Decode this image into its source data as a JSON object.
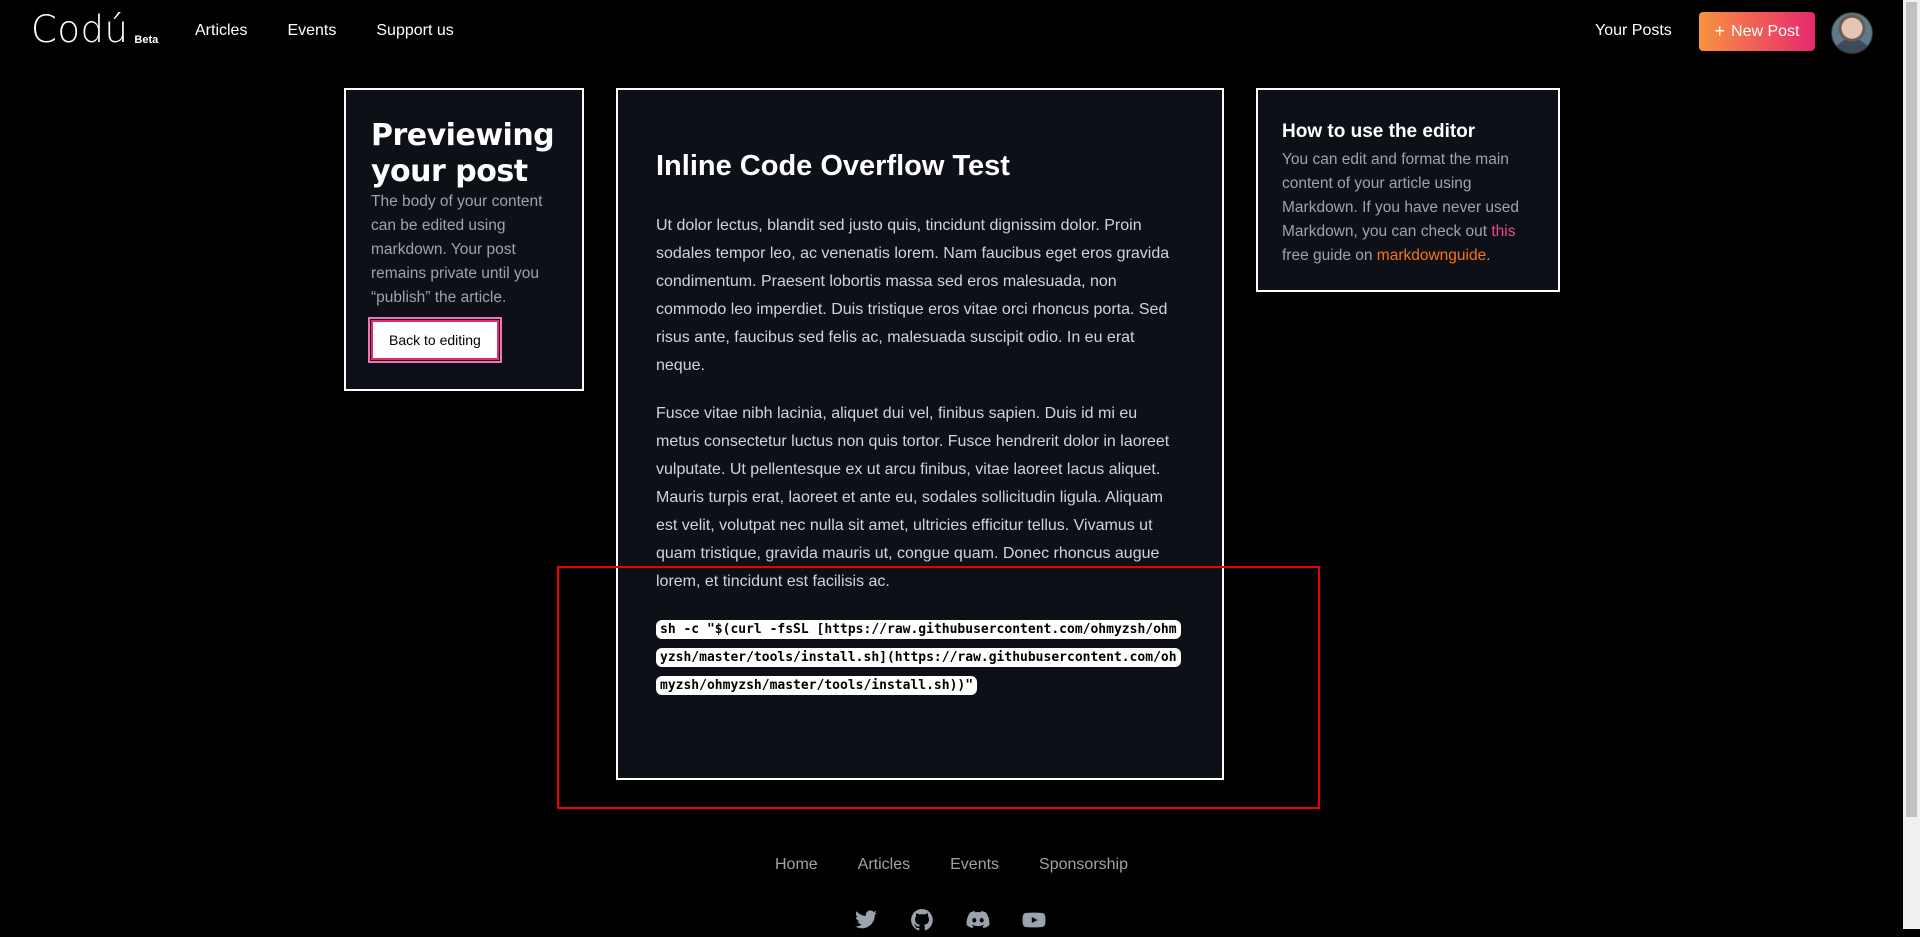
{
  "header": {
    "logo_text": "Codú",
    "logo_badge": "Beta",
    "nav": [
      "Articles",
      "Events",
      "Support us"
    ],
    "your_posts": "Your Posts",
    "new_post_icon": "+",
    "new_post_label": "New Post"
  },
  "left_panel": {
    "title": "Previewing your post",
    "description": "The body of your content can be edited using markdown. Your post remains private until you “publish” the article.",
    "back_button": "Back to editing"
  },
  "article": {
    "title": "Inline Code Overflow Test",
    "paragraphs": [
      "Ut dolor lectus, blandit sed justo quis, tincidunt dignissim dolor. Proin sodales tempor leo, ac venenatis lorem. Nam faucibus eget eros gravida condimentum. Praesent lobortis massa sed eros malesuada, non commodo leo imperdiet. Duis tristique eros vitae orci rhoncus porta. Sed risus ante, faucibus sed felis ac, malesuada suscipit odio. In eu erat neque.",
      "Fusce vitae nibh lacinia, aliquet dui vel, finibus sapien. Duis id mi eu metus consectetur luctus non quis tortor. Fusce hendrerit dolor in laoreet vulputate. Ut pellentesque ex ut arcu finibus, vitae laoreet lacus aliquet. Mauris turpis erat, laoreet et ante eu, sodales sollicitudin ligula. Aliquam est velit, volutpat nec nulla sit amet, ultricies efficitur tellus. Vivamus ut quam tristique, gravida mauris ut, congue quam. Donec rhoncus augue lorem, et tincidunt est facilisis ac."
    ],
    "code_lines": [
      "sh -c \"$(curl -fsSL",
      "[https://raw.githubusercontent.com/ohmyzsh/ohmyzsh/master/tools/install.sh](https://raw.githubusercontent.com/ohmyzsh/ohmyzsh/master/tools/install.sh))\""
    ]
  },
  "right_panel": {
    "title": "How to use the editor",
    "description_1": "You can edit and format the main content of your article using Markdown. If you have never used Markdown, you can check out ",
    "link_this": "this",
    "description_2": " free guide on ",
    "link_guide": "markdownguide",
    "description_3": "."
  },
  "footer": {
    "links": [
      "Home",
      "Articles",
      "Events",
      "Sponsorship"
    ],
    "social_icons": [
      "twitter-icon",
      "github-icon",
      "discord-icon",
      "youtube-icon"
    ]
  },
  "colors": {
    "accent_gradient_start": "#f8933f",
    "accent_gradient_end": "#e6286e",
    "link_pink": "#ec4899",
    "link_orange": "#f97316",
    "highlight_box": "#ee0000"
  }
}
